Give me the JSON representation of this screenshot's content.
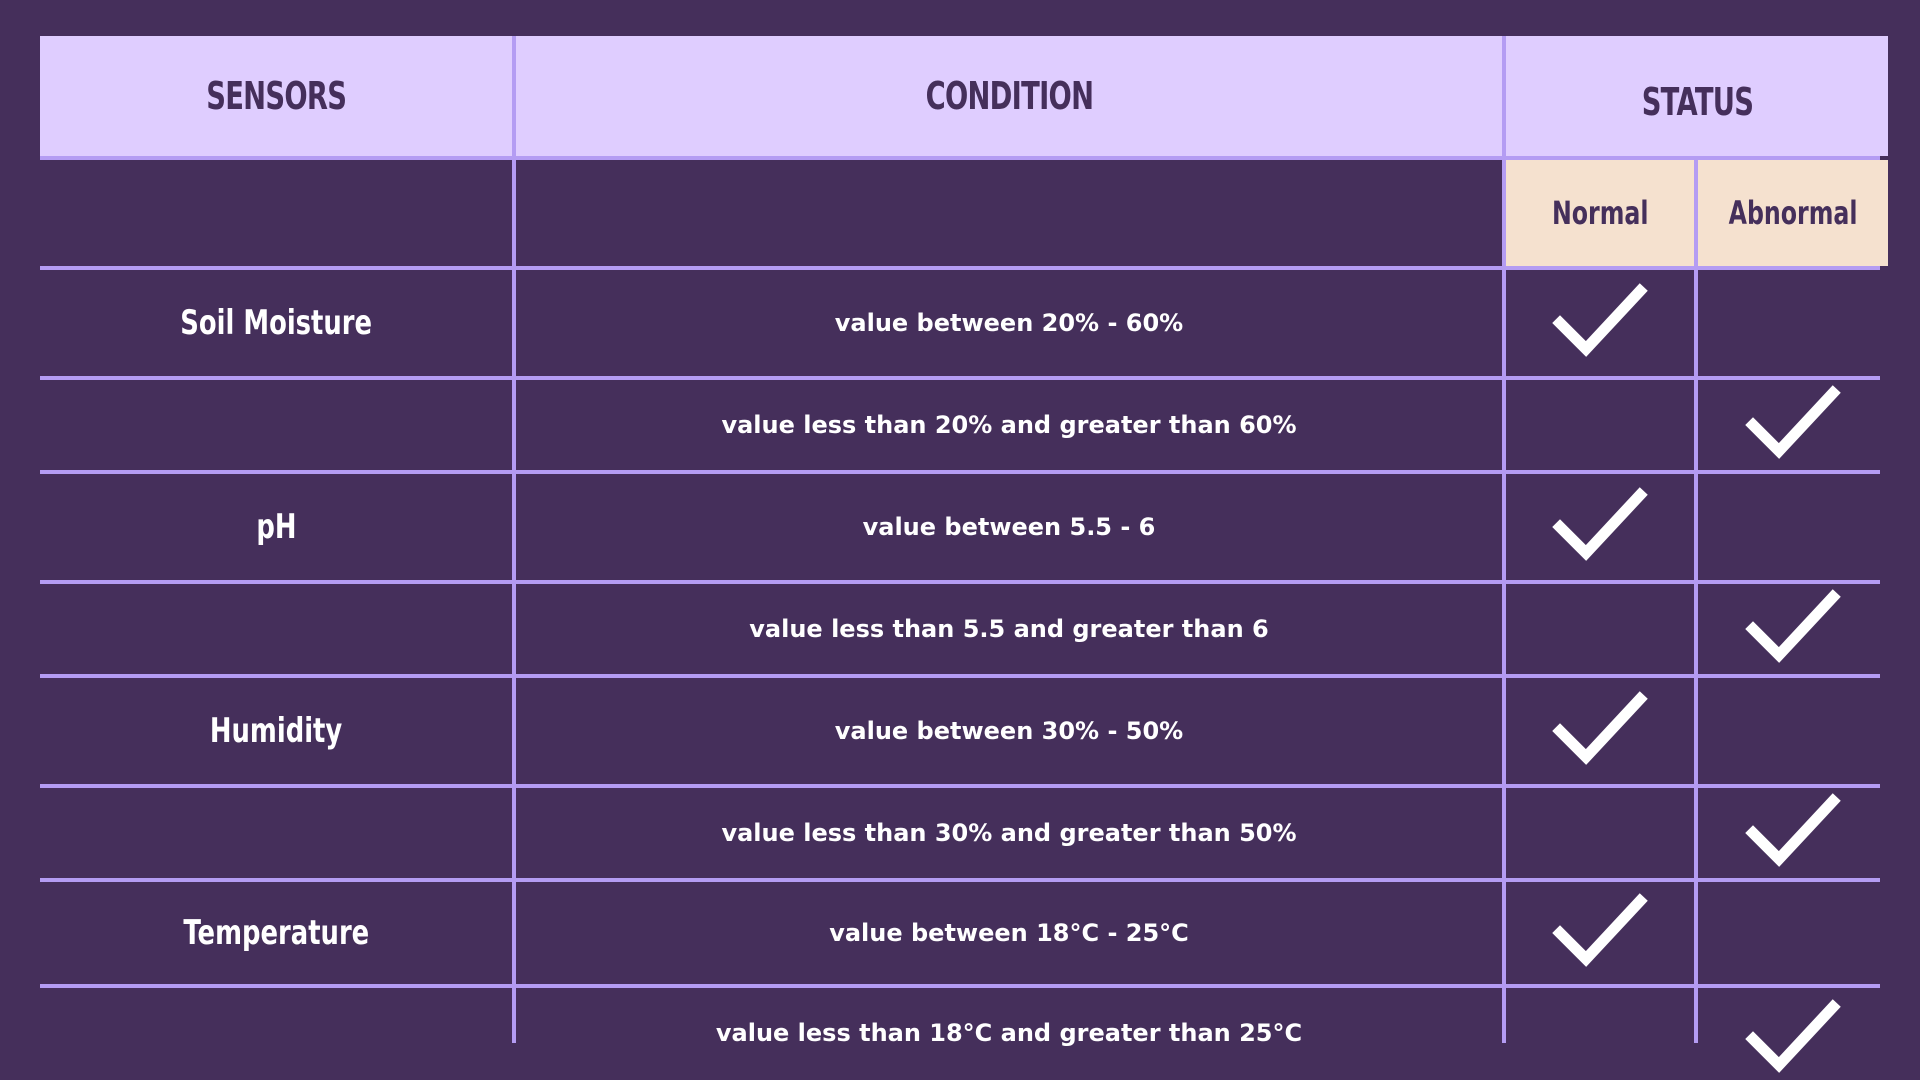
{
  "table": {
    "headers": {
      "sensors": "SENSORS",
      "condition": "CONDITION",
      "status": "STATUS",
      "normal": "Normal",
      "abnormal": "Abnormal"
    },
    "rows": [
      {
        "sensor": "Soil Moisture",
        "condition": "value between 20% - 60%",
        "status": "normal"
      },
      {
        "sensor": "",
        "condition": "value less than 20% and greater than 60%",
        "status": "abnormal"
      },
      {
        "sensor": "pH",
        "condition": "value between 5.5 - 6",
        "status": "normal"
      },
      {
        "sensor": "",
        "condition": "value less than 5.5 and greater than 6",
        "status": "abnormal"
      },
      {
        "sensor": "Humidity",
        "condition": "value between 30% - 50%",
        "status": "normal"
      },
      {
        "sensor": "",
        "condition": "value less than 30% and greater than 50%",
        "status": "abnormal"
      },
      {
        "sensor": "Temperature",
        "condition": "value between 18°C - 25°C",
        "status": "normal"
      },
      {
        "sensor": "",
        "condition": "value less than 18°C and greater than 25°C",
        "status": "abnormal"
      }
    ]
  },
  "colors": {
    "background": "#452f5b",
    "header_fill": "#dfcdff",
    "subheader_fill": "#f5e1cf",
    "grid_line": "#b49cf3",
    "text_dark": "#452f5b",
    "text_light": "#ffffff"
  },
  "icons": {
    "status_mark": "checkmark-icon"
  }
}
